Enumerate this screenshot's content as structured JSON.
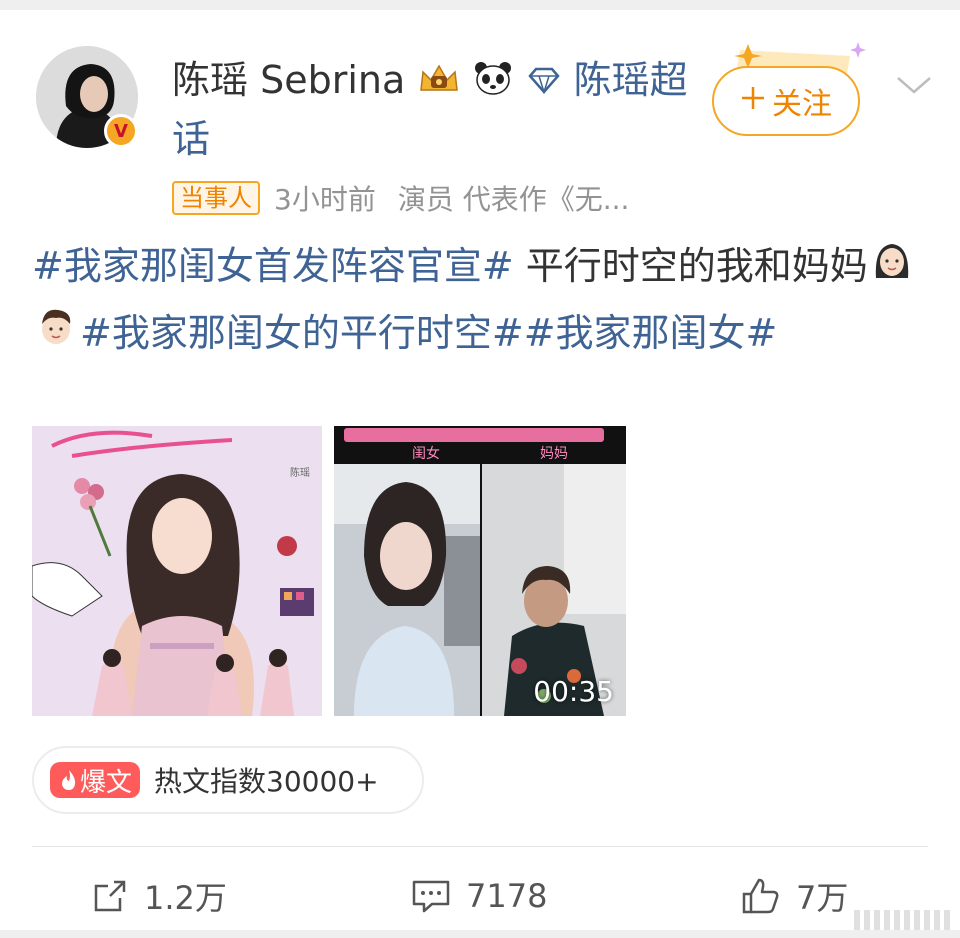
{
  "user": {
    "name": "陈瑶 Sebrina",
    "super_topic": "陈瑶超话",
    "verified_badge": "V",
    "follow_label": "关注",
    "party_tag": "当事人",
    "time": "3小时前",
    "bio": "演员 代表作《无..."
  },
  "post": {
    "t1": "#我家那闺女首发阵容官宣#",
    "t2": " 平行时空的我和妈妈",
    "t3": "#我家那闺女的平行时空#",
    "t4": "#我家那闺女#"
  },
  "media": {
    "video_duration": "00:35",
    "video_caption_left": "闺女",
    "video_caption_right": "妈妈",
    "poster_small_text": "陈瑶"
  },
  "hot": {
    "pill_label": "爆文",
    "text": "热文指数30000+"
  },
  "actions": {
    "repost_count": "1.2万",
    "comment_count": "7178",
    "like_count": "7万"
  },
  "colors": {
    "topic_blue": "#3e6394",
    "follow_orange": "#f08300",
    "hot_red": "#ff5b5b"
  }
}
